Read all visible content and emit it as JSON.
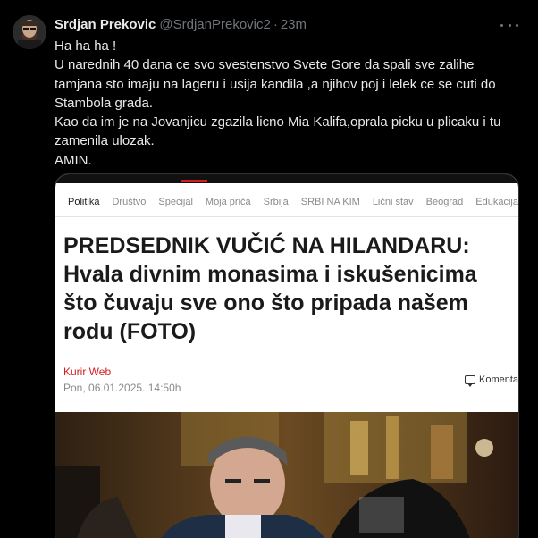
{
  "author": {
    "name": "Srdjan Prekovic",
    "handle": "@SrdjanPrekovic2",
    "separator": "·",
    "time": "23m"
  },
  "tweet": {
    "lines": [
      "Ha ha ha !",
      "U narednih 40 dana ce svo svestenstvo Svete Gore da spali sve zalihe",
      "tamjana sto imaju na lageru i usija kandila ,a njihov poj i lelek ce se cuti do",
      "Stambola grada.",
      "Kao da im je na Jovanjicu zgazila licno Mia Kalifa,oprala picku u plicaku i tu",
      "zamenila ulozak.",
      "AMIN."
    ]
  },
  "card": {
    "nav": [
      "Politika",
      "Društvo",
      "Specijal",
      "Moja priča",
      "Srbija",
      "SRBI NA KIM",
      "Lični stav",
      "Beograd",
      "Edukacija"
    ],
    "headline_lines": [
      "PREDSEDNIK VUČIĆ NA HILANDARU:",
      "Hvala divnim monasima i iskušenicima",
      "što čuvaju sve ono što pripada našem",
      "rodu (FOTO)"
    ],
    "source": "Kurir Web",
    "date": "Pon, 06.01.2025. 14:50h",
    "comments_label": "Komentari"
  },
  "icons": {
    "more": "more-icon",
    "comment": "comment-icon"
  },
  "colors": {
    "accent": "#d21d23",
    "muted": "#71767b",
    "text": "#e7e9ea"
  }
}
